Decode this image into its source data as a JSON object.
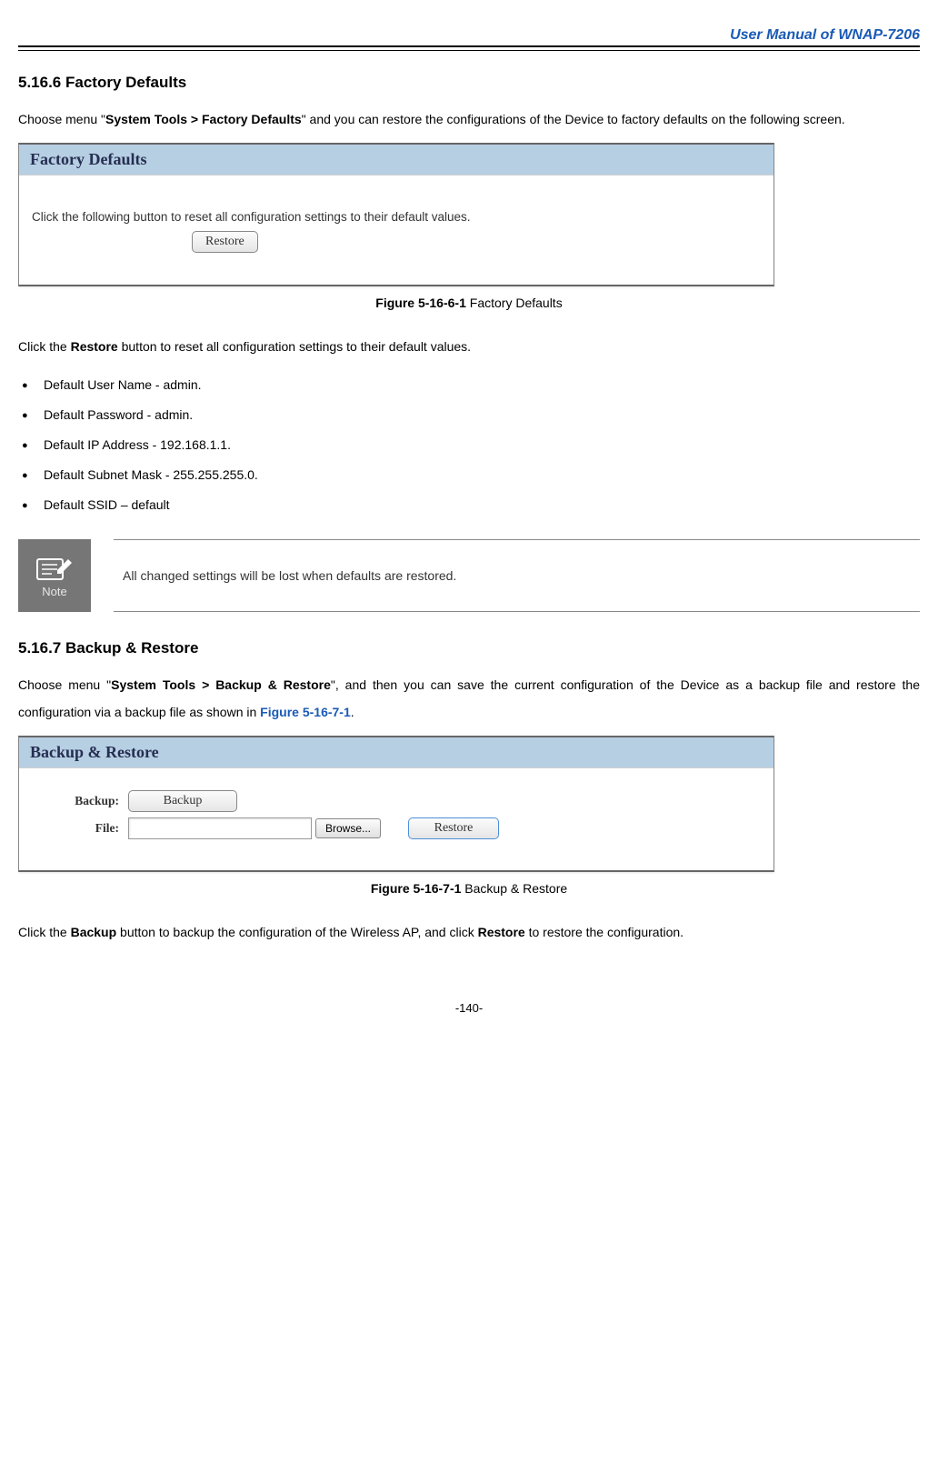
{
  "header": {
    "manual_title": "User Manual of WNAP-7206"
  },
  "section1": {
    "heading": "5.16.6 Factory Defaults",
    "intro_pre": "Choose menu \"",
    "intro_bold": "System Tools > Factory Defaults",
    "intro_post": "\" and you can restore the configurations of the Device to factory defaults on the following screen.",
    "panel": {
      "title": "Factory Defaults",
      "desc": "Click the following button to reset all configuration settings to their default values.",
      "restore_btn": "Restore"
    },
    "figcap_bold": "Figure 5-16-6-1",
    "figcap_rest": " Factory Defaults",
    "after_pre": "Click the ",
    "after_bold": "Restore",
    "after_post": " button to reset all configuration settings to their default values.",
    "bullets": [
      "Default User Name - admin.",
      "Default Password - admin.",
      "Default IP Address - 192.168.1.1.",
      "Default Subnet Mask - 255.255.255.0.",
      "Default SSID – default"
    ],
    "note_label": "Note",
    "note_text": "All changed settings will be lost when defaults are restored."
  },
  "section2": {
    "heading": "5.16.7 Backup & Restore",
    "intro_pre": "Choose menu \"",
    "intro_bold": "System Tools > Backup & Restore",
    "intro_post": "\", and then you can save the current configuration of the Device as a backup file and restore the configuration via a backup file as shown in ",
    "intro_link": "Figure 5-16-7-1",
    "intro_end": ".",
    "panel": {
      "title": "Backup & Restore",
      "label_backup": "Backup:",
      "btn_backup": "Backup",
      "label_file": "File:",
      "btn_browse": "Browse...",
      "btn_restore": "Restore"
    },
    "figcap_bold": "Figure 5-16-7-1",
    "figcap_rest": " Backup & Restore",
    "after_pre": "Click the ",
    "after_bold1": "Backup",
    "after_mid": " button to backup the configuration of the Wireless AP, and click ",
    "after_bold2": "Restore",
    "after_post": " to restore the configuration."
  },
  "footer": {
    "page": "-140-"
  }
}
